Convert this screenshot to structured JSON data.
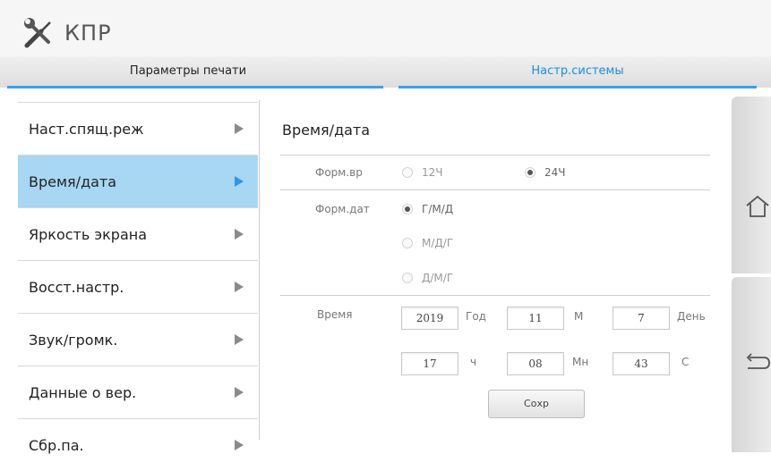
{
  "app": {
    "title": "КПР",
    "icon": "tools-icon"
  },
  "tabs": [
    {
      "label": "Параметры печати",
      "active": false
    },
    {
      "label": "Настр.системы",
      "active": true
    }
  ],
  "colors": {
    "accent": "#3aa0ea",
    "active_item_bg": "#a8d7f3",
    "active_tab_text": "#1a8de0"
  },
  "menu": {
    "items": [
      {
        "label": "Наст.спящ.реж",
        "active": false
      },
      {
        "label": "Время/дата",
        "active": true
      },
      {
        "label": "Яркость экрана",
        "active": false
      },
      {
        "label": "Восст.настр.",
        "active": false
      },
      {
        "label": "Звук/громк.",
        "active": false
      },
      {
        "label": "Данные о вер.",
        "active": false
      },
      {
        "label": "Сбр.па.",
        "active": false
      }
    ]
  },
  "content": {
    "title": "Время/дата",
    "time_format": {
      "label": "Форм.вр",
      "options": [
        {
          "label": "12Ч",
          "selected": false
        },
        {
          "label": "24Ч",
          "selected": true
        }
      ]
    },
    "date_format": {
      "label": "Форм.дат",
      "options": [
        {
          "label": "Г/М/Д",
          "selected": true
        },
        {
          "label": "М/Д/Г",
          "selected": false
        },
        {
          "label": "Д/М/Г",
          "selected": false
        }
      ]
    },
    "time": {
      "label": "Время",
      "year": {
        "value": "2019",
        "unit": "Год"
      },
      "month": {
        "value": "11",
        "unit": "М"
      },
      "day": {
        "value": "7",
        "unit": "День"
      },
      "hour": {
        "value": "17",
        "unit": "ч"
      },
      "minute": {
        "value": "08",
        "unit": "Мн"
      },
      "second": {
        "value": "43",
        "unit": "С"
      }
    },
    "save_label": "Сохр"
  },
  "rail": {
    "top_icon": "home-icon",
    "bottom_icon": "back-icon"
  }
}
